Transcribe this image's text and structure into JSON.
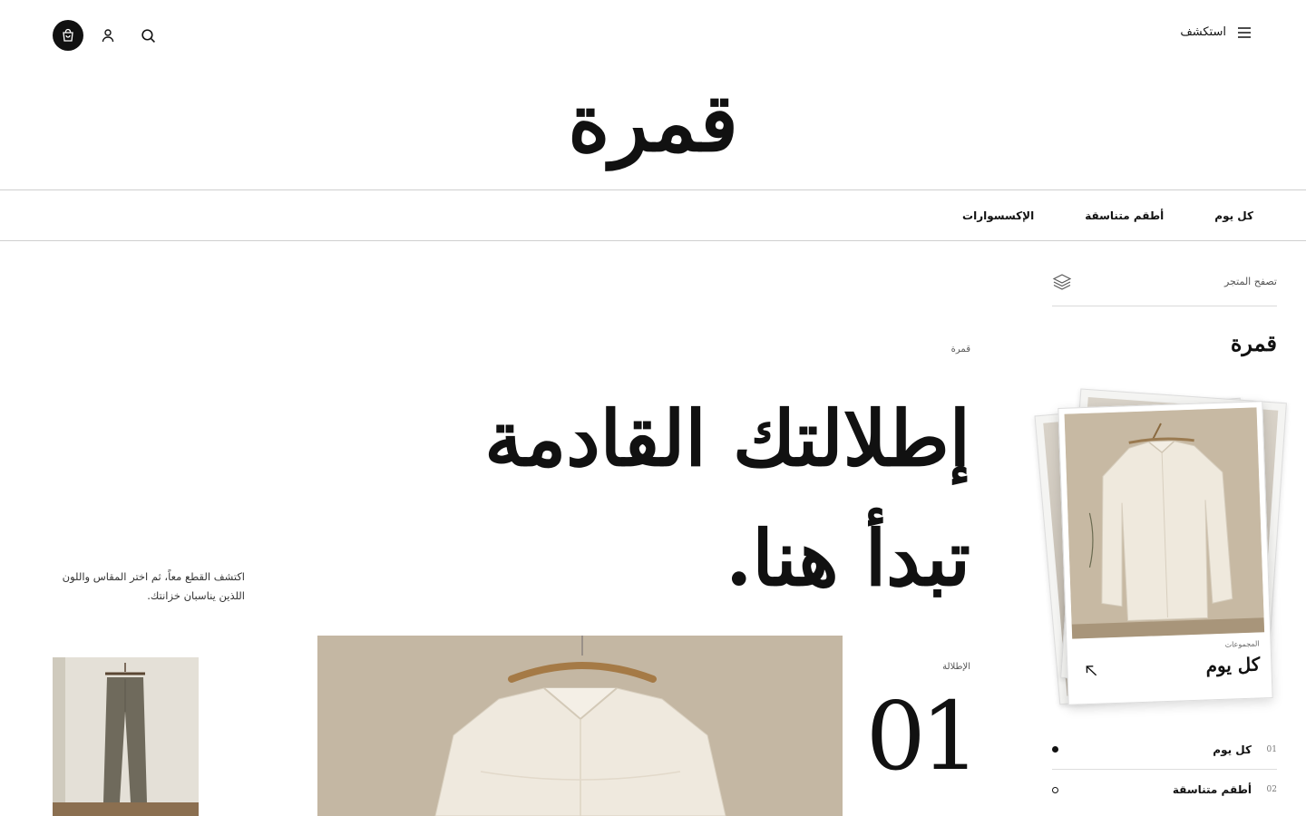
{
  "header": {
    "explore_label": "استكشف",
    "logo": "قمرة",
    "icons": [
      "cart-icon",
      "user-icon",
      "search-icon",
      "menu-icon"
    ]
  },
  "nav": {
    "items": [
      "كل يوم",
      "أطقم متناسقة",
      "الإكسسوارات"
    ]
  },
  "sidebar": {
    "browse_label": "تصفح المتجر",
    "brand": "قمرة",
    "card": {
      "label": "المجموعات",
      "title": "كل يوم"
    },
    "collections": [
      {
        "num": "01",
        "label": "كل يوم",
        "active": true
      },
      {
        "num": "02",
        "label": "أطقم متناسقة",
        "active": false
      }
    ]
  },
  "hero": {
    "eyebrow": "قمرة",
    "title_line1": "إطلالتك القادمة",
    "title_line2": "تبدأ هنا.",
    "blurb": "اكتشف القطع معاً، ثم اختر المقاس واللون اللذين يناسبان خزانتك.",
    "look_label": "الإطلالة",
    "look_number": "01"
  },
  "colors": {
    "text": "#111111",
    "muted": "#555555",
    "divider": "#cfcfcf",
    "photo_bg": "#c3b6a2"
  }
}
